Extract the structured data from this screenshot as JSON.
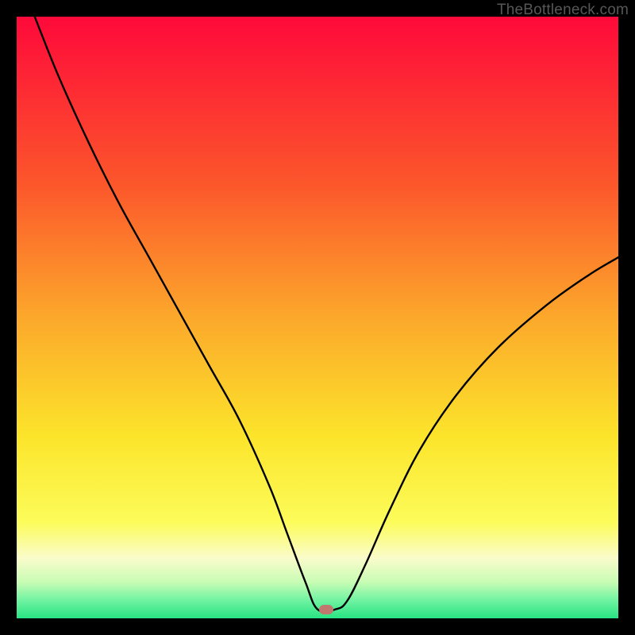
{
  "watermark": "TheBottleneck.com",
  "marker": {
    "color": "#c0776d",
    "x_pct": 51.5,
    "y_pct": 98.6
  },
  "chart_data": {
    "type": "line",
    "title": "",
    "xlabel": "",
    "ylabel": "",
    "xlim": [
      0,
      100
    ],
    "ylim": [
      0,
      100
    ],
    "grid": false,
    "background_gradient": [
      {
        "stop": 0.0,
        "color": "#fe093a"
      },
      {
        "stop": 0.28,
        "color": "#fc572b"
      },
      {
        "stop": 0.5,
        "color": "#fca82b"
      },
      {
        "stop": 0.7,
        "color": "#fce52b"
      },
      {
        "stop": 0.84,
        "color": "#fcfc5a"
      },
      {
        "stop": 0.9,
        "color": "#fafccb"
      },
      {
        "stop": 0.94,
        "color": "#c8fcb4"
      },
      {
        "stop": 0.97,
        "color": "#70f3a2"
      },
      {
        "stop": 1.0,
        "color": "#27e383"
      }
    ],
    "series": [
      {
        "name": "bottleneck-curve",
        "x": [
          3.0,
          7.0,
          12.0,
          17.0,
          22.0,
          27.0,
          32.0,
          37.0,
          42.0,
          45.0,
          48.0,
          50.0,
          53.0,
          55.0,
          58.0,
          62.0,
          67.0,
          73.0,
          80.0,
          88.0,
          95.0,
          100.0
        ],
        "y": [
          100.0,
          90.0,
          79.0,
          69.0,
          60.0,
          51.0,
          42.0,
          33.0,
          22.0,
          14.0,
          6.0,
          1.5,
          1.5,
          3.0,
          9.0,
          18.0,
          28.0,
          37.0,
          45.0,
          52.0,
          57.0,
          60.0
        ]
      }
    ],
    "marker_point": {
      "x": 51.5,
      "y": 1.5
    }
  }
}
